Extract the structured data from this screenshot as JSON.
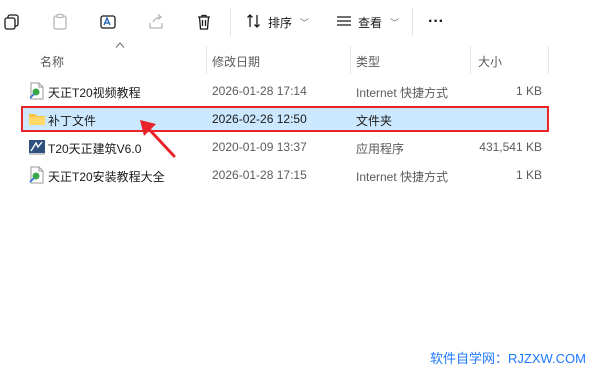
{
  "toolbar": {
    "sort_label": "排序",
    "view_label": "查看",
    "more_label": "···"
  },
  "columns": {
    "name": "名称",
    "modified": "修改日期",
    "type": "类型",
    "size": "大小"
  },
  "files": [
    {
      "name": "天正T20视频教程",
      "modified": "2026-01-28 17:14",
      "type": "Internet 快捷方式",
      "size": "1 KB",
      "icon": "internet-shortcut-icon"
    },
    {
      "name": "补丁文件",
      "modified": "2026-02-26 12:50",
      "type": "文件夹",
      "size": "",
      "icon": "folder-icon",
      "selected": true
    },
    {
      "name": "T20天正建筑V6.0",
      "modified": "2020-01-09 13:37",
      "type": "应用程序",
      "size": "431,541 KB",
      "icon": "application-icon"
    },
    {
      "name": "天正T20安装教程大全",
      "modified": "2026-01-28 17:15",
      "type": "Internet 快捷方式",
      "size": "1 KB",
      "icon": "internet-shortcut-icon"
    }
  ],
  "watermark": "软件自学网：RJZXW.COM",
  "colors": {
    "selection": "#cce8ff",
    "highlight_box": "#e8232a",
    "watermark": "#1e78ff"
  }
}
